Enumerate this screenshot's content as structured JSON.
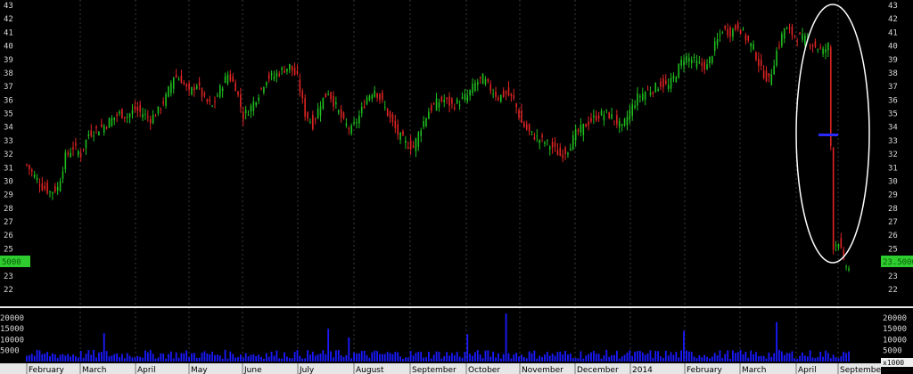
{
  "chart_data": {
    "type": "candlestick",
    "colors": {
      "background": "#000000",
      "up": "#1fbf1f",
      "down": "#e02424",
      "volume": "#1a1aff",
      "annotation": "#ffffff",
      "gap_marker": "#2a2aff",
      "badge_bg": "#2ecc2e"
    },
    "price_axis": {
      "min": 22,
      "max": 43,
      "ticks": [
        43,
        42,
        41,
        40,
        39,
        38,
        37,
        36,
        35,
        34,
        33,
        32,
        31,
        30,
        29,
        28,
        27,
        26,
        25,
        24,
        23,
        22
      ]
    },
    "volume_axis": {
      "max": 22000,
      "left_ticks": [
        "20000",
        "15000",
        "10000",
        "5000"
      ],
      "right_ticks": [
        "20000",
        "15000",
        "10000",
        "5000"
      ],
      "unit_label": "x1000"
    },
    "last_price": {
      "right": "23.5000",
      "left": "5000",
      "value": 23.5
    },
    "month_labels": [
      "February",
      "March",
      "April",
      "May",
      "June",
      "July",
      "August",
      "September",
      "October",
      "November",
      "December",
      "2014",
      "February",
      "March",
      "April",
      "September"
    ],
    "grid": "vertical dashed (monthly)",
    "annotation": "ellipse around price gap down",
    "close_path": [
      [
        0,
        31.2
      ],
      [
        3,
        30.4
      ],
      [
        6,
        29.6
      ],
      [
        9,
        29.2
      ],
      [
        12,
        29.5
      ],
      [
        15,
        31.8
      ],
      [
        18,
        32.5
      ],
      [
        21,
        32.0
      ],
      [
        24,
        33.5
      ],
      [
        27,
        33.8
      ],
      [
        30,
        34.1
      ],
      [
        33,
        34.6
      ],
      [
        36,
        35.0
      ],
      [
        39,
        34.8
      ],
      [
        42,
        35.3
      ],
      [
        45,
        35.0
      ],
      [
        48,
        34.6
      ],
      [
        51,
        35.2
      ],
      [
        54,
        36.2
      ],
      [
        57,
        37.8
      ],
      [
        60,
        37.5
      ],
      [
        63,
        36.5
      ],
      [
        66,
        37.2
      ],
      [
        69,
        36.0
      ],
      [
        72,
        35.5
      ],
      [
        75,
        36.8
      ],
      [
        78,
        37.9
      ],
      [
        81,
        37.0
      ],
      [
        84,
        34.8
      ],
      [
        87,
        35.5
      ],
      [
        90,
        36.5
      ],
      [
        93,
        37.6
      ],
      [
        96,
        37.8
      ],
      [
        99,
        38.2
      ],
      [
        102,
        38.5
      ],
      [
        105,
        37.6
      ],
      [
        108,
        35.0
      ],
      [
        111,
        34.2
      ],
      [
        114,
        35.8
      ],
      [
        117,
        36.6
      ],
      [
        120,
        35.5
      ],
      [
        123,
        34.3
      ],
      [
        126,
        33.8
      ],
      [
        129,
        34.8
      ],
      [
        132,
        36.2
      ],
      [
        135,
        36.8
      ],
      [
        138,
        35.8
      ],
      [
        141,
        34.6
      ],
      [
        144,
        33.5
      ],
      [
        147,
        32.8
      ],
      [
        150,
        32.5
      ],
      [
        153,
        34.0
      ],
      [
        156,
        35.2
      ],
      [
        159,
        35.8
      ],
      [
        162,
        36.0
      ],
      [
        165,
        35.6
      ],
      [
        168,
        35.9
      ],
      [
        171,
        36.3
      ],
      [
        174,
        37.2
      ],
      [
        177,
        37.6
      ],
      [
        180,
        36.8
      ],
      [
        183,
        36.2
      ],
      [
        186,
        36.5
      ],
      [
        189,
        36.0
      ],
      [
        192,
        34.3
      ],
      [
        195,
        33.6
      ],
      [
        198,
        33.2
      ],
      [
        201,
        32.9
      ],
      [
        204,
        32.5
      ],
      [
        207,
        31.9
      ],
      [
        210,
        32.4
      ],
      [
        213,
        33.5
      ],
      [
        216,
        34.0
      ],
      [
        219,
        34.5
      ],
      [
        222,
        34.9
      ],
      [
        225,
        35.0
      ],
      [
        228,
        34.6
      ],
      [
        231,
        33.9
      ],
      [
        234,
        35.2
      ],
      [
        237,
        36.2
      ],
      [
        240,
        36.6
      ],
      [
        243,
        36.8
      ],
      [
        246,
        37.2
      ],
      [
        249,
        37.0
      ],
      [
        252,
        38.0
      ],
      [
        255,
        39.2
      ],
      [
        258,
        39.0
      ],
      [
        261,
        38.6
      ],
      [
        264,
        38.5
      ],
      [
        267,
        40.0
      ],
      [
        270,
        41.2
      ],
      [
        273,
        41.0
      ],
      [
        276,
        41.5
      ],
      [
        279,
        40.6
      ],
      [
        282,
        39.8
      ],
      [
        285,
        38.2
      ],
      [
        288,
        37.4
      ],
      [
        291,
        39.6
      ],
      [
        294,
        41.3
      ],
      [
        297,
        40.9
      ],
      [
        300,
        40.6
      ],
      [
        303,
        40.4
      ],
      [
        306,
        40.0
      ],
      [
        309,
        39.6
      ],
      [
        311,
        40.0
      ],
      [
        313,
        25.2
      ],
      [
        315,
        25.6
      ],
      [
        317,
        24.0
      ],
      [
        319,
        23.5
      ]
    ],
    "volume_spikes": [
      [
        30,
        13000
      ],
      [
        117,
        15000
      ],
      [
        125,
        11000
      ],
      [
        171,
        12500
      ],
      [
        186,
        22000
      ],
      [
        255,
        14000
      ],
      [
        291,
        18000
      ]
    ]
  }
}
